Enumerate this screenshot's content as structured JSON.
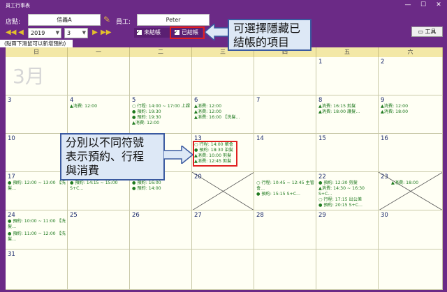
{
  "window": {
    "title": "員工行事表",
    "min": "—",
    "max": "☐",
    "close": "✕"
  },
  "toolbar": {
    "store_label": "店點:",
    "store_value": "信義A",
    "employee_label": "員工:",
    "employee_value": "Peter",
    "year": "2019",
    "month": "3",
    "unsettled_label": "未結帳",
    "settled_label": "已結帳",
    "tools_label": "工具",
    "hint": "(點兩下滑鼠可以新增預約)"
  },
  "calendar": {
    "month_title": "3月",
    "weekdays": [
      "日",
      "一",
      "二",
      "三",
      "四",
      "五",
      "六"
    ],
    "days": {
      "d1": "1",
      "d2": "2",
      "d3": "3",
      "d4": "4",
      "d5": "5",
      "d6": "6",
      "d7": "7",
      "d8": "8",
      "d9": "9",
      "d10": "10",
      "d13": "13",
      "d14": "14",
      "d15": "15",
      "d16": "16",
      "d17": "17",
      "d20": "20",
      "d22": "22",
      "d23": "23",
      "d24": "24",
      "d25": "25",
      "d26": "26",
      "d27": "27",
      "d28": "28",
      "d29": "29",
      "d30": "30",
      "d31": "31"
    },
    "events": {
      "e4a": "▲消費: 12:00",
      "e5a": "○ 行程: 14:00 ~ 17:00 上課",
      "e5b": "● 預約: 19:30",
      "e5c": "● 預約: 19:30",
      "e5d": "▲消費: 12:00",
      "e6a": "▲消費: 12:00",
      "e6b": "▲消費: 12:00",
      "e6c": "▲消費: 16:00 【洗髮...",
      "e8a": "▲消費: 16:15 剪髮",
      "e8b": "▲消費: 18:00 護髮...",
      "e9a": "▲消費: 12:00",
      "e9b": "▲消費: 18:00",
      "e13a": "○ 行程: 14:00 聚會",
      "e13b": "● 預約: 18:30 染髮",
      "e13c": "▲消費: 10:00 剪髮",
      "e13d": "▲消費: 12:45 剪髮",
      "e17a": "● 預約: 12:00 ~ 13:00 【洗",
      "e17b": "髮...",
      "e18a": "● 預約: 14:15 ~ 15:00",
      "e18b": "S+C...",
      "e19a": "● 預約: 16:00",
      "e19b": "● 預約: 14:00",
      "e21a": "○ 行程: 10:45 ~ 12:45 主管",
      "e21b": "會...",
      "e21c": "● 預約: 15:15 S+C...",
      "e22a": "● 預約: 12:30 剪髮",
      "e22b": "▲消費: 14:30 ~ 16:30",
      "e22c": "S+C...",
      "e22d": "○ 行程: 17:15 出公差",
      "e22e": "● 預約: 20:15 S+C...",
      "e23a": "▲消費: 18:00",
      "e24a": "● 預約: 10:00 ~ 11:00 【洗",
      "e24b": "髮...",
      "e24c": "● 預約: 11:00 ~ 12:00 【洗",
      "e24d": "髮..."
    }
  },
  "callouts": {
    "top_line1": "可選擇隱藏已",
    "top_line2": "結帳的項目",
    "mid_line1": "分別以不同符號",
    "mid_line2": "表示預約、行程",
    "mid_line3": "與消費"
  }
}
